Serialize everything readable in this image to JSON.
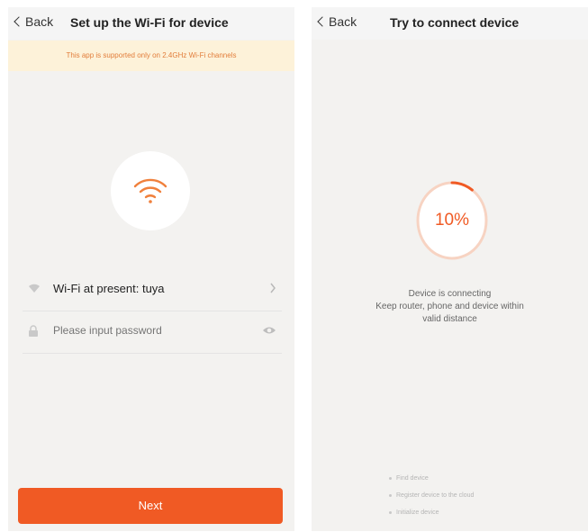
{
  "left_screen": {
    "back_label": "Back",
    "title": "Set up the Wi-Fi for device",
    "banner": "This app is supported only on 2.4GHz Wi-Fi channels",
    "wifi_row": {
      "label": "Wi-Fi at present: tuya",
      "icon": "wifi-small-icon"
    },
    "password_row": {
      "placeholder": "Please input password",
      "icon": "lock-icon"
    },
    "next_label": "Next"
  },
  "right_screen": {
    "back_label": "Back",
    "title": "Try to connect device",
    "progress": {
      "value": 0.1,
      "label": "10%"
    },
    "status_lines": [
      "Device is connecting",
      "Keep router, phone and device within",
      "valid distance"
    ],
    "steps": [
      "Find device",
      "Register device to the cloud",
      "Initialize device"
    ]
  },
  "colors": {
    "accent": "#f05a24",
    "banner_bg": "#fdf2d9",
    "banner_text": "#e27d3a",
    "background": "#f3f2f0"
  }
}
